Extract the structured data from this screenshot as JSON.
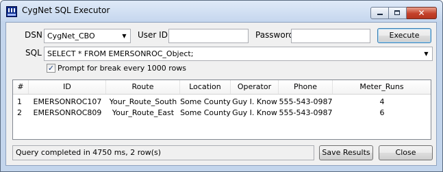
{
  "window": {
    "title": "CygNet SQL Executor"
  },
  "form": {
    "dsn_label": "DSN",
    "dsn_value": "CygNet_CBO",
    "userid_label": "User ID",
    "userid_value": "",
    "password_label": "Password",
    "password_value": "",
    "execute_label": "Execute",
    "sql_label": "SQL",
    "sql_value": "SELECT * FROM EMERSONROC_Object;",
    "prompt_checked": true,
    "prompt_label": "Prompt for break every 1000 rows"
  },
  "table": {
    "columns": [
      "#",
      "ID",
      "Route",
      "Location",
      "Operator",
      "Phone",
      "Meter_Runs"
    ],
    "rows": [
      [
        "1",
        "EMERSONROC107",
        "Your_Route_South",
        "Some County",
        "Guy I. Know",
        "555-543-0987",
        "4"
      ],
      [
        "2",
        "EMERSONROC809",
        "Your_Route_East",
        "Some County",
        "Guy I. Know",
        "555-543-0987",
        "6"
      ]
    ]
  },
  "footer": {
    "status_text": "Query completed in 4750 ms,  2 row(s)",
    "save_label": "Save Results",
    "close_label": "Close"
  },
  "icons": {
    "app": "cygnet-app-icon",
    "dropdown": "chevron-down-icon",
    "check": "checkmark-icon"
  }
}
